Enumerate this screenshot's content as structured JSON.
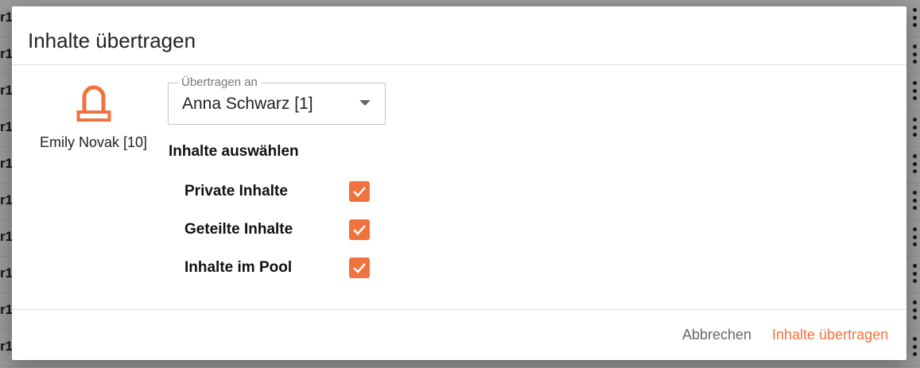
{
  "background": {
    "row_fragment": "r1",
    "rows": 10
  },
  "dialog": {
    "title": "Inhalte übertragen",
    "source_user": {
      "name": "Emily Novak [10]",
      "icon": "user-badge-icon"
    },
    "transfer_to": {
      "label": "Übertragen an",
      "value": "Anna Schwarz [1]"
    },
    "section_title": "Inhalte auswählen",
    "options": [
      {
        "label": "Private Inhalte",
        "checked": true
      },
      {
        "label": "Geteilte Inhalte",
        "checked": true
      },
      {
        "label": "Inhalte im Pool",
        "checked": true
      }
    ],
    "actions": {
      "cancel": "Abbrechen",
      "submit": "Inhalte übertragen"
    }
  },
  "colors": {
    "accent": "#f0733f",
    "overlay": "#9a9a9a"
  }
}
